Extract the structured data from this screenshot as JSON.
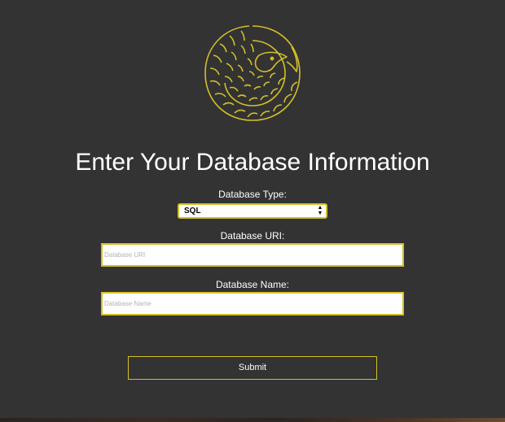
{
  "colors": {
    "background": "#333333",
    "accent": "#d4bf29",
    "text": "#ffffff",
    "placeholder": "#b3b3b3"
  },
  "logo": {
    "icon": "pangolin-logo-icon"
  },
  "form": {
    "title": "Enter Your Database Information",
    "db_type": {
      "label": "Database Type:",
      "selected": "SQL"
    },
    "db_uri": {
      "label": "Database URI:",
      "placeholder": "Database URI"
    },
    "db_name": {
      "label": "Database Name:",
      "placeholder": "Database Name"
    },
    "submit_label": "Submit"
  }
}
